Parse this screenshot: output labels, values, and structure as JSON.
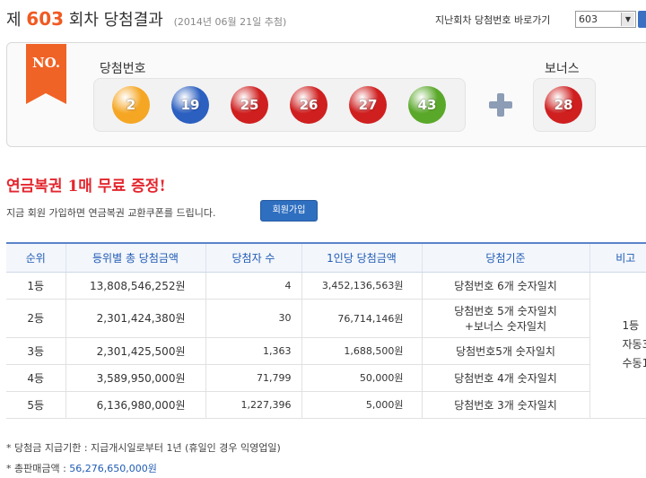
{
  "header": {
    "title_prefix": "제",
    "round_number": "603",
    "title_suffix": "회차 당첨결과",
    "draw_date": "(2014년 06월 21일 추첨)",
    "jump_label": "지난회차 당첨번호 바로가기",
    "selected_round": "603"
  },
  "result": {
    "no_tag": "NO.",
    "winning_label": "당첨번호",
    "bonus_label": "보너스",
    "numbers": [
      "2",
      "19",
      "25",
      "26",
      "27",
      "43"
    ],
    "bonus": "28",
    "ball_colors": [
      "#f5a623",
      "#2b5fc0",
      "#cf1f1f",
      "#cf1f1f",
      "#cf1f1f",
      "#5aa82a"
    ],
    "bonus_color": "#cf1f1f"
  },
  "promo": {
    "headline": "연금복권 1매 무료 증정!",
    "subtext": "지금 회원 가입하면 연금복권 교환쿠폰를 드립니다.",
    "join_button": "회원가입"
  },
  "table": {
    "headers": [
      "순위",
      "등위별 총 당첨금액",
      "당첨자 수",
      "1인당 당첨금액",
      "당첨기준",
      "비고"
    ],
    "rows": [
      {
        "rank": "1등",
        "total": "13,808,546,252원",
        "winners": "4",
        "per_winner": "3,452,136,563원",
        "criteria": "당첨번호 6개 숫자일치"
      },
      {
        "rank": "2등",
        "total": "2,301,424,380원",
        "winners": "30",
        "per_winner": "76,714,146원",
        "criteria": "당첨번호 5개 숫자일치",
        "criteria2": "+보너스 숫자일치"
      },
      {
        "rank": "3등",
        "total": "2,301,425,500원",
        "winners": "1,363",
        "per_winner": "1,688,500원",
        "criteria": "당첨번호5개 숫자일치"
      },
      {
        "rank": "4등",
        "total": "3,589,950,000원",
        "winners": "71,799",
        "per_winner": "50,000원",
        "criteria": "당첨번호 4개 숫자일치"
      },
      {
        "rank": "5등",
        "total": "6,136,980,000원",
        "winners": "1,227,396",
        "per_winner": "5,000원",
        "criteria": "당첨번호 3개 숫자일치"
      }
    ],
    "note_lines": [
      "1등",
      "자동3",
      "수동1"
    ]
  },
  "footer": {
    "payout_note": "* 당첨금 지급기한 : 지급개시일로부터 1년 (휴일인 경우 익영업일)",
    "sales_label": "* 총판매금액 : ",
    "sales_amount": "56,276,650,000원"
  }
}
